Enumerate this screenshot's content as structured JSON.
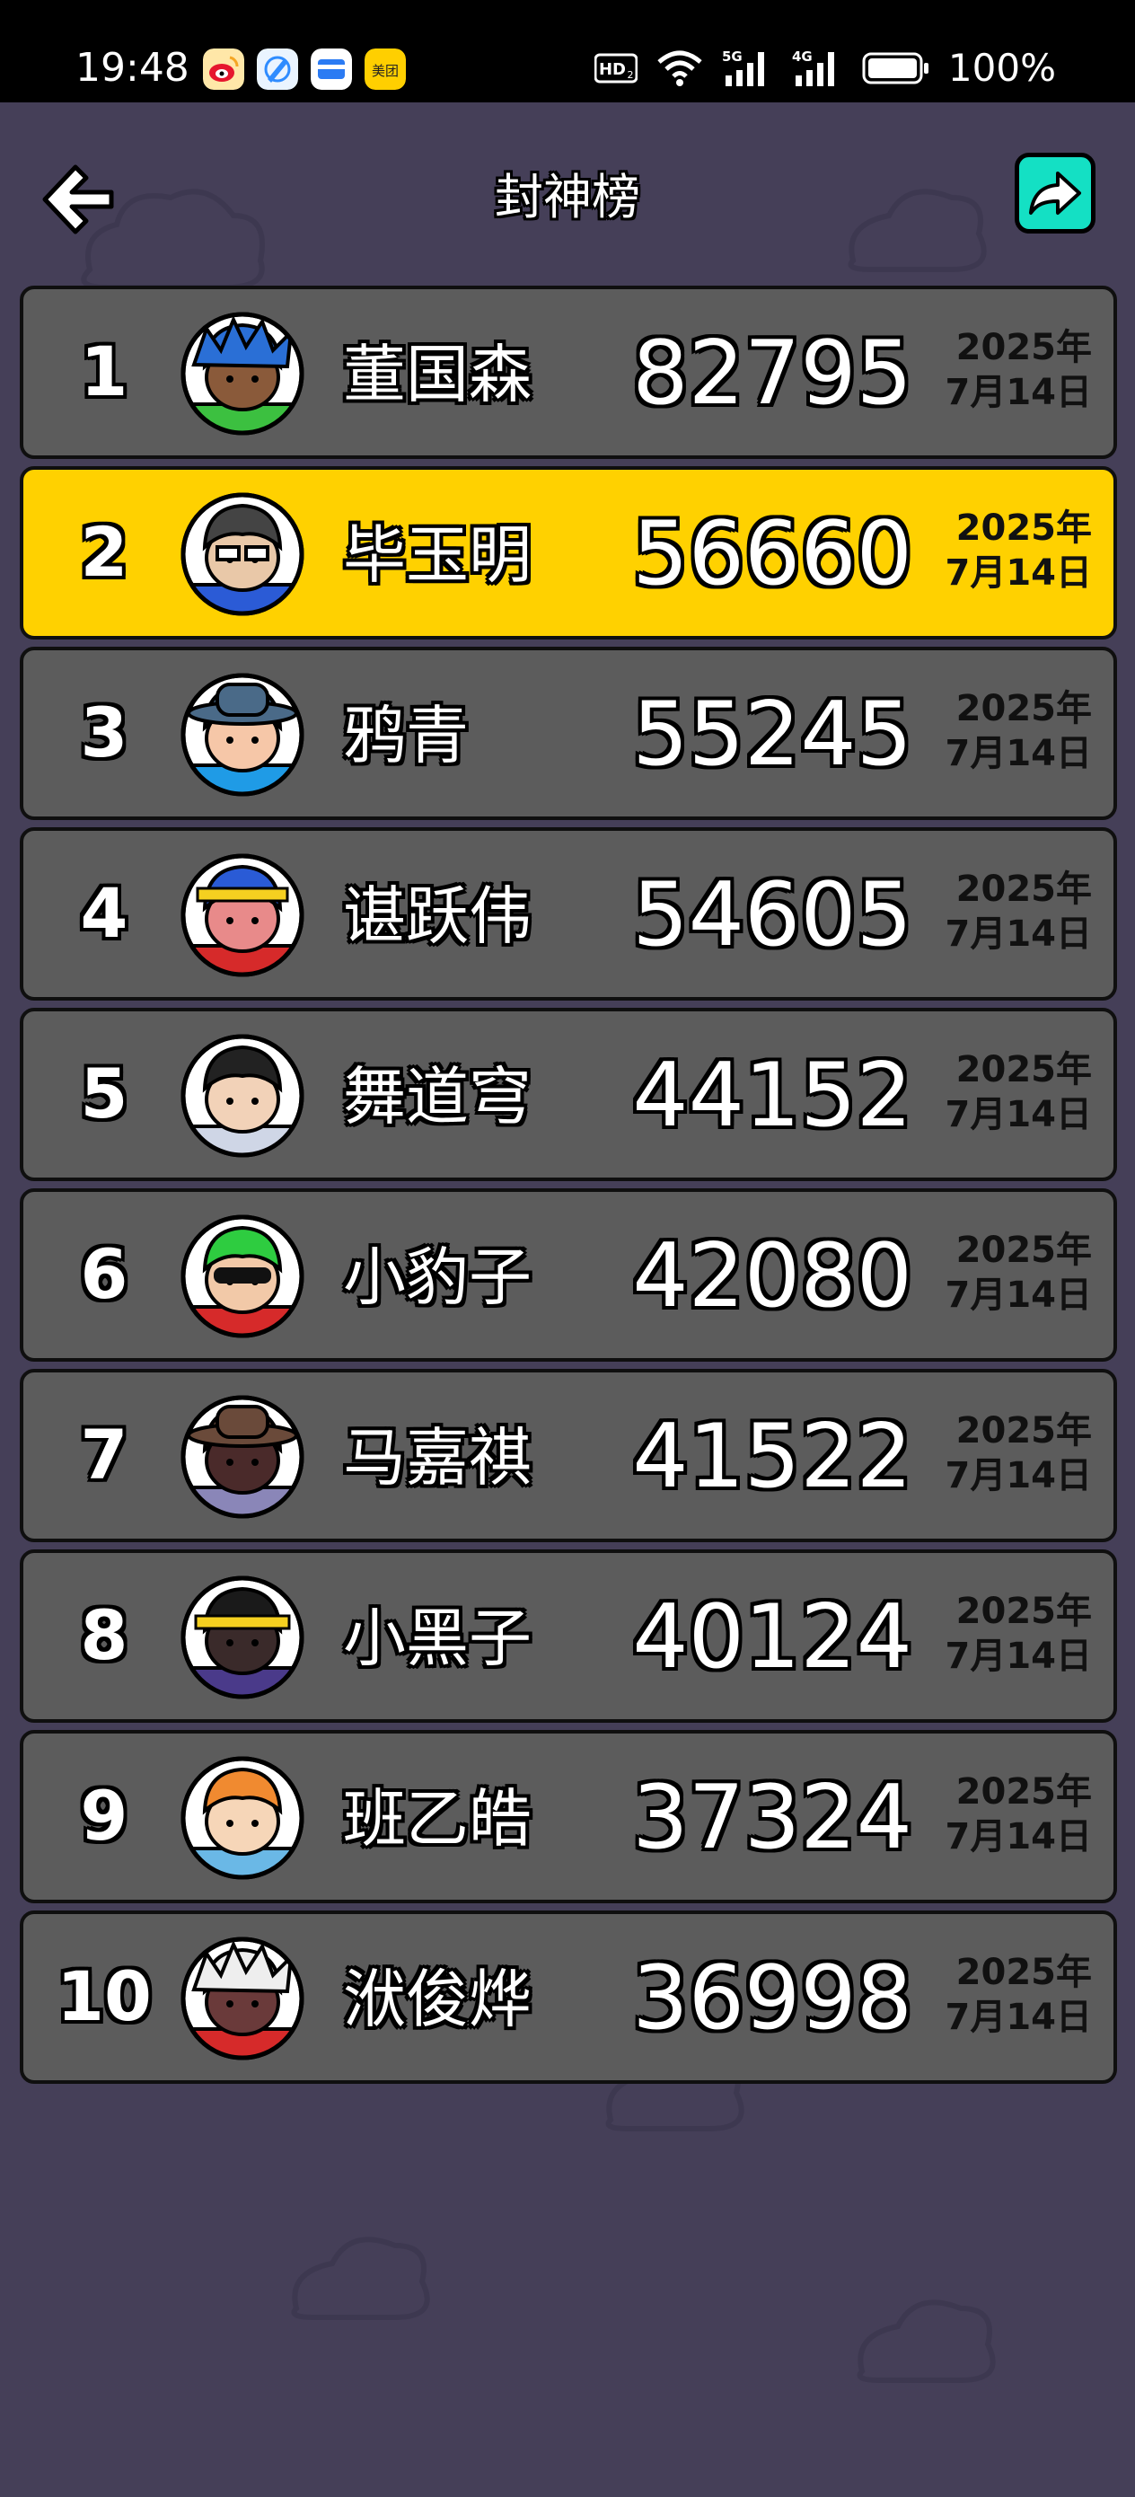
{
  "status_bar": {
    "time": "19:48",
    "app_icons": [
      "weibo-icon",
      "browser-icon",
      "wallet-icon",
      "meituan-icon"
    ],
    "meituan_label": "美团",
    "network_hd": "HD",
    "network_5g": "5G",
    "network_4g": "4G",
    "battery": "100%"
  },
  "header": {
    "title": "封神榜",
    "back_icon": "back-arrow-icon",
    "share_icon": "share-icon"
  },
  "leaderboard": [
    {
      "rank": "1",
      "name": "董国森",
      "score": "82795",
      "date_year": "2025年",
      "date_day": "7月14日",
      "highlight": false,
      "avatar": "avatar-blue-hair"
    },
    {
      "rank": "2",
      "name": "毕玉明",
      "score": "56660",
      "date_year": "2025年",
      "date_day": "7月14日",
      "highlight": true,
      "avatar": "avatar-glasses"
    },
    {
      "rank": "3",
      "name": "鸦青",
      "score": "55245",
      "date_year": "2025年",
      "date_day": "7月14日",
      "highlight": false,
      "avatar": "avatar-hat"
    },
    {
      "rank": "4",
      "name": "谌跃伟",
      "score": "54605",
      "date_year": "2025年",
      "date_day": "7月14日",
      "highlight": false,
      "avatar": "avatar-headband"
    },
    {
      "rank": "5",
      "name": "舞道穹",
      "score": "44152",
      "date_year": "2025年",
      "date_day": "7月14日",
      "highlight": false,
      "avatar": "avatar-dark-hair"
    },
    {
      "rank": "6",
      "name": "小豹子",
      "score": "42080",
      "date_year": "2025年",
      "date_day": "7月14日",
      "highlight": false,
      "avatar": "avatar-green-hair"
    },
    {
      "rank": "7",
      "name": "马嘉祺",
      "score": "41522",
      "date_year": "2025年",
      "date_day": "7月14日",
      "highlight": false,
      "avatar": "avatar-brown-hat"
    },
    {
      "rank": "8",
      "name": "小黑子",
      "score": "40124",
      "date_year": "2025年",
      "date_day": "7月14日",
      "highlight": false,
      "avatar": "avatar-dreadlocks"
    },
    {
      "rank": "9",
      "name": "班乙皓",
      "score": "37324",
      "date_year": "2025年",
      "date_day": "7月14日",
      "highlight": false,
      "avatar": "avatar-orange-hair"
    },
    {
      "rank": "10",
      "name": "洑俊烨",
      "score": "36998",
      "date_year": "2025年",
      "date_day": "7月14日",
      "highlight": false,
      "avatar": "avatar-white-hair"
    }
  ],
  "colors": {
    "background": "#453f58",
    "row_normal": "#5c5c5c",
    "row_highlight": "#ffd100",
    "share_button": "#14e0c4"
  }
}
